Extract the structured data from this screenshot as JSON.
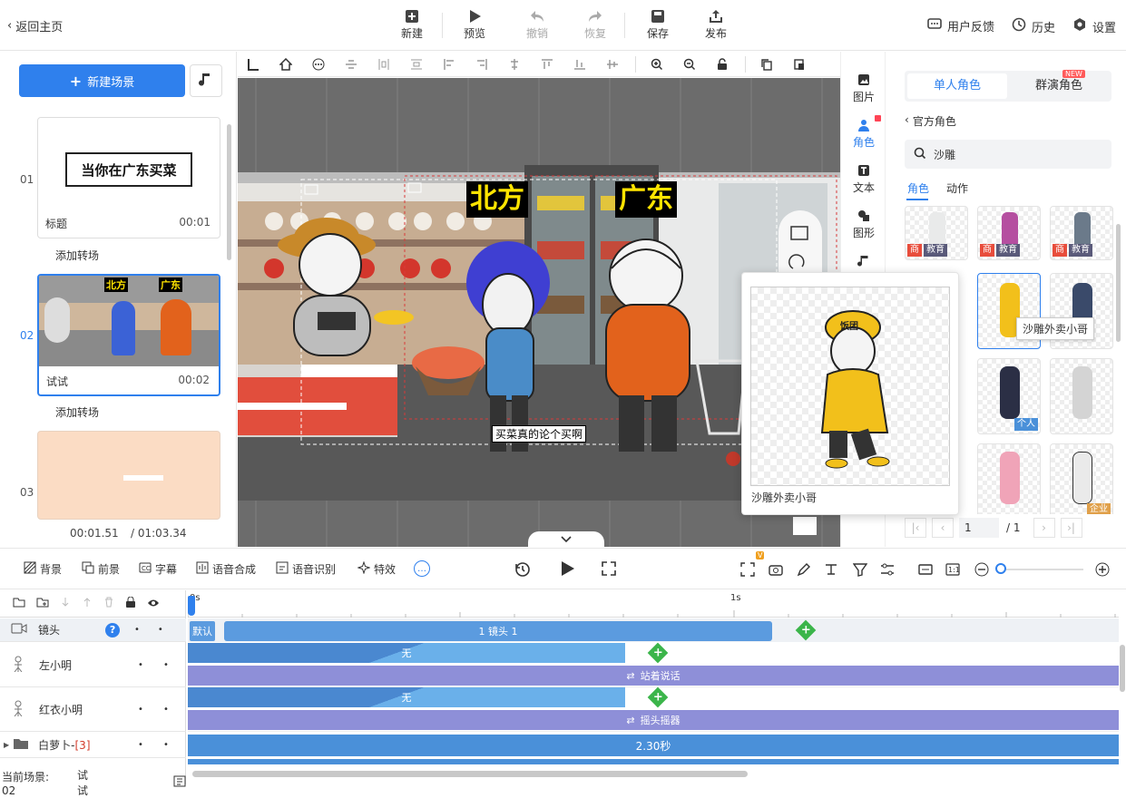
{
  "topbar": {
    "back_label": "返回主页",
    "new_label": "新建",
    "preview_label": "预览",
    "undo_label": "撤销",
    "redo_label": "恢复",
    "save_label": "保存",
    "publish_label": "发布",
    "feedback_label": "用户反馈",
    "history_label": "历史",
    "settings_label": "设置"
  },
  "left": {
    "new_scene_label": "新建场景",
    "scenes": [
      {
        "num": "01",
        "name": "标题",
        "time": "00:01",
        "thumb_text": "当你在广东买菜"
      },
      {
        "num": "02",
        "name": "试试",
        "time": "00:02"
      },
      {
        "num": "03"
      }
    ],
    "add_transition_label": "添加转场",
    "current_time": "00:01.51",
    "total_time": "/ 01:03.34"
  },
  "canvas": {
    "caption_north": "北方",
    "caption_guangdong": "广东",
    "subtitle": "买菜真的论个买啊"
  },
  "rail": {
    "image_label": "图片",
    "role_label": "角色",
    "text_label": "文本",
    "shape_label": "图形",
    "music_label": "音乐"
  },
  "rpanel": {
    "tab_single": "单人角色",
    "tab_group": "群演角色",
    "new_badge": "NEW",
    "official_label": "官方角色",
    "search_value": "沙雕",
    "subtab_role": "角色",
    "subtab_action": "动作",
    "tag_shang": "商",
    "tag_edu": "教育",
    "tag_personal": "个人",
    "tag_enterprise": "企业",
    "page_current": "1",
    "page_total": "/ 1"
  },
  "popup": {
    "name": "沙雕外卖小哥",
    "badge_text": "饭团"
  },
  "tooltip": "沙雕外卖小哥",
  "btool": {
    "bg": "背景",
    "fg": "前景",
    "subtitle": "字幕",
    "tts": "语音合成",
    "asr": "语音识别",
    "effects": "特效"
  },
  "timeline": {
    "tick0": "0s",
    "tick1": "1s",
    "camera_label": "镜头",
    "default_label": "默认",
    "camera_clip": "1 镜头 1",
    "tracks": [
      {
        "label": "左小明",
        "clip": "无",
        "action": "站着说话"
      },
      {
        "label": "红衣小明",
        "clip": "无",
        "action": "摇头摇器"
      }
    ],
    "group_label": "白萝卜-",
    "group_count": "[3]",
    "group_clip": "2.30秒",
    "status_scene": "当前场景: 02",
    "status_name": "试试"
  },
  "colors": {
    "accent": "#2f80ed",
    "track_blue": "#4a90d9",
    "track_purple": "#8e8fd8",
    "add_green": "#3bb54a"
  }
}
